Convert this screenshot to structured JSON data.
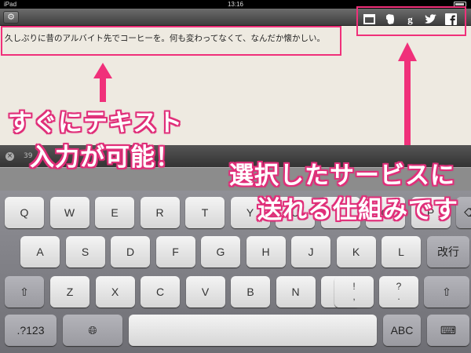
{
  "status": {
    "device": "iPad",
    "time": "13:16"
  },
  "editor": {
    "text": "久しぶりに昔のアルバイト先でコーヒーを。何も変わってなくて、なんだか懐かしい。"
  },
  "strip": {
    "count": "39"
  },
  "services": [
    "window-icon",
    "evernote-icon",
    "google-icon",
    "twitter-icon",
    "facebook-icon"
  ],
  "callouts": {
    "left_line1": "すぐにテキスト",
    "left_line2": "入力が可能！",
    "right_line1": "選択したサービスに",
    "right_line2": "送れる仕組みです"
  },
  "keys": {
    "row1": [
      "Q",
      "W",
      "E",
      "R",
      "T",
      "Y",
      "U",
      "I",
      "O",
      "P"
    ],
    "row2": [
      "A",
      "S",
      "D",
      "F",
      "G",
      "H",
      "J",
      "K",
      "L"
    ],
    "return": "改行",
    "row3": [
      "Z",
      "X",
      "C",
      "V",
      "B",
      "N",
      "M"
    ],
    "punct1": "!\n,",
    "punct2": "?\n.",
    "numbers": ".?123",
    "abc": "ABC"
  },
  "colors": {
    "accent": "#f0307a"
  }
}
